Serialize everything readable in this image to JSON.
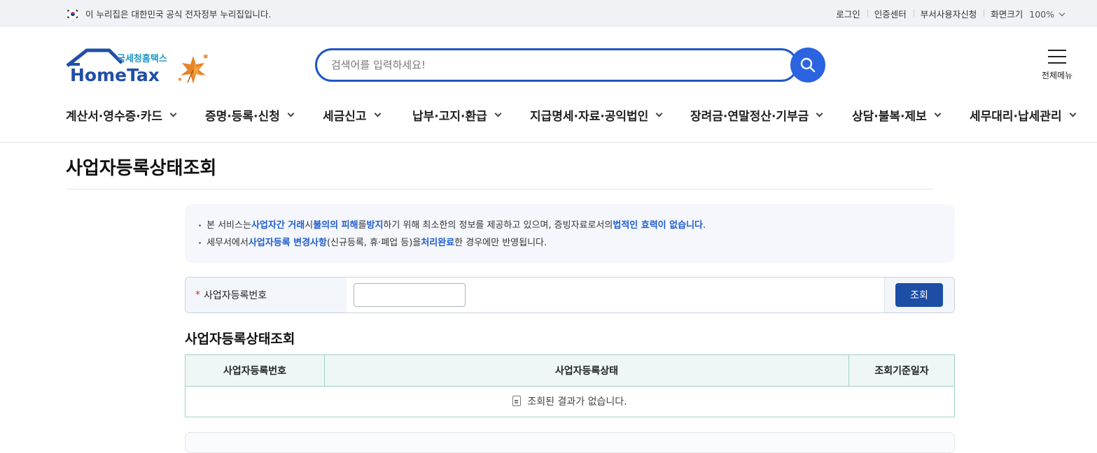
{
  "gov_bar": {
    "notice": "이 누리집은 대한민국 공식 전자정부 누리집입니다.",
    "links": [
      "로그인",
      "인증센터",
      "부서사용자신청",
      "화면크기"
    ],
    "zoom": "100%"
  },
  "header": {
    "logo_sub": "국세청홈택스",
    "logo_main": "HomeTax",
    "search_placeholder": "검색어를 입력하세요!",
    "menu_label": "전체메뉴"
  },
  "nav": {
    "items": [
      "계산서·영수증·카드",
      "증명·등록·신청",
      "세금신고",
      "납부·고지·환급",
      "지급명세·자료·공익법인",
      "장려금·연말정산·기부금",
      "상담·불복·제보",
      "세무대리·납세관리"
    ]
  },
  "page": {
    "title": "사업자등록상태조회"
  },
  "notice": {
    "line1": {
      "p1": "본 서비스는 ",
      "h1": "사업자간 거래",
      "p2": " 시 ",
      "h2": "불의의 피해",
      "p3": "를 ",
      "h3": "방지",
      "p4": "하기 위해 최소한의 정보를 제공하고 있으며, 증빙자료로서의 ",
      "h4": "법적인 효력이 없습니다",
      "p5": "."
    },
    "line2": {
      "p1": "세무서에서 ",
      "h1": "사업자등록 변경사항",
      "p2": "(신규등록, 휴·폐업 등)을 ",
      "h2": "처리완료",
      "p3": "한 경우에만 반영됩니다."
    }
  },
  "form": {
    "required_mark": "*",
    "label": "사업자등록번호",
    "value": "",
    "button": "조회"
  },
  "results": {
    "title": "사업자등록상태조회",
    "columns": [
      "사업자등록번호",
      "사업자등록상태",
      "조회기준일자"
    ],
    "empty_message": "조회된 결과가 없습니다."
  },
  "colors": {
    "brand_blue": "#1f57c3",
    "highlight": "#1f5dd1",
    "button": "#1d4ea6",
    "table_border": "#9fd1c7"
  }
}
